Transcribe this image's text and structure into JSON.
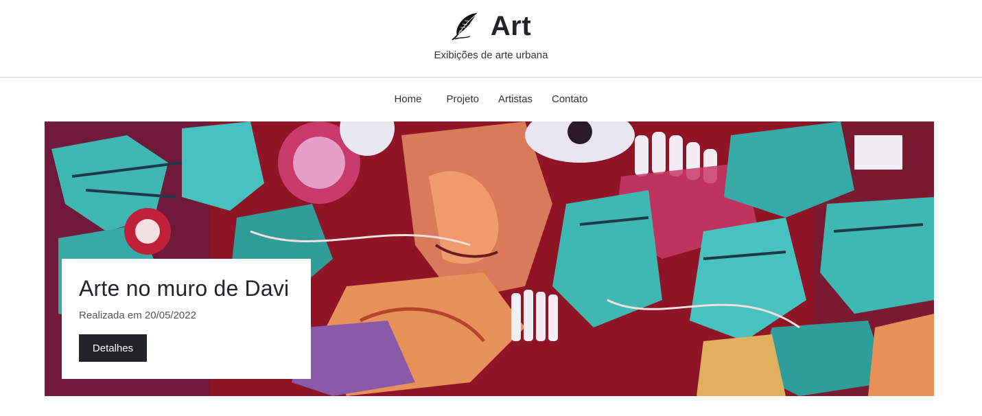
{
  "header": {
    "brand_title": "Art",
    "brand_icon": "feather-quill-icon",
    "subtitle": "Exibições de arte urbana"
  },
  "nav": {
    "items": [
      "Home",
      "Projeto",
      "Artistas",
      "Contato"
    ]
  },
  "hero": {
    "image": "graffiti-mural-image",
    "card": {
      "title": "Arte no muro de Davi",
      "date": "Realizada em 20/05/2022",
      "button": "Detalhes"
    }
  },
  "colors": {
    "text": "#212529",
    "button_bg": "#212529",
    "mural_red": "#a8142c",
    "mural_teal": "#3fb8b4",
    "mural_orange": "#f0a050",
    "mural_purple": "#8a5aa8"
  }
}
